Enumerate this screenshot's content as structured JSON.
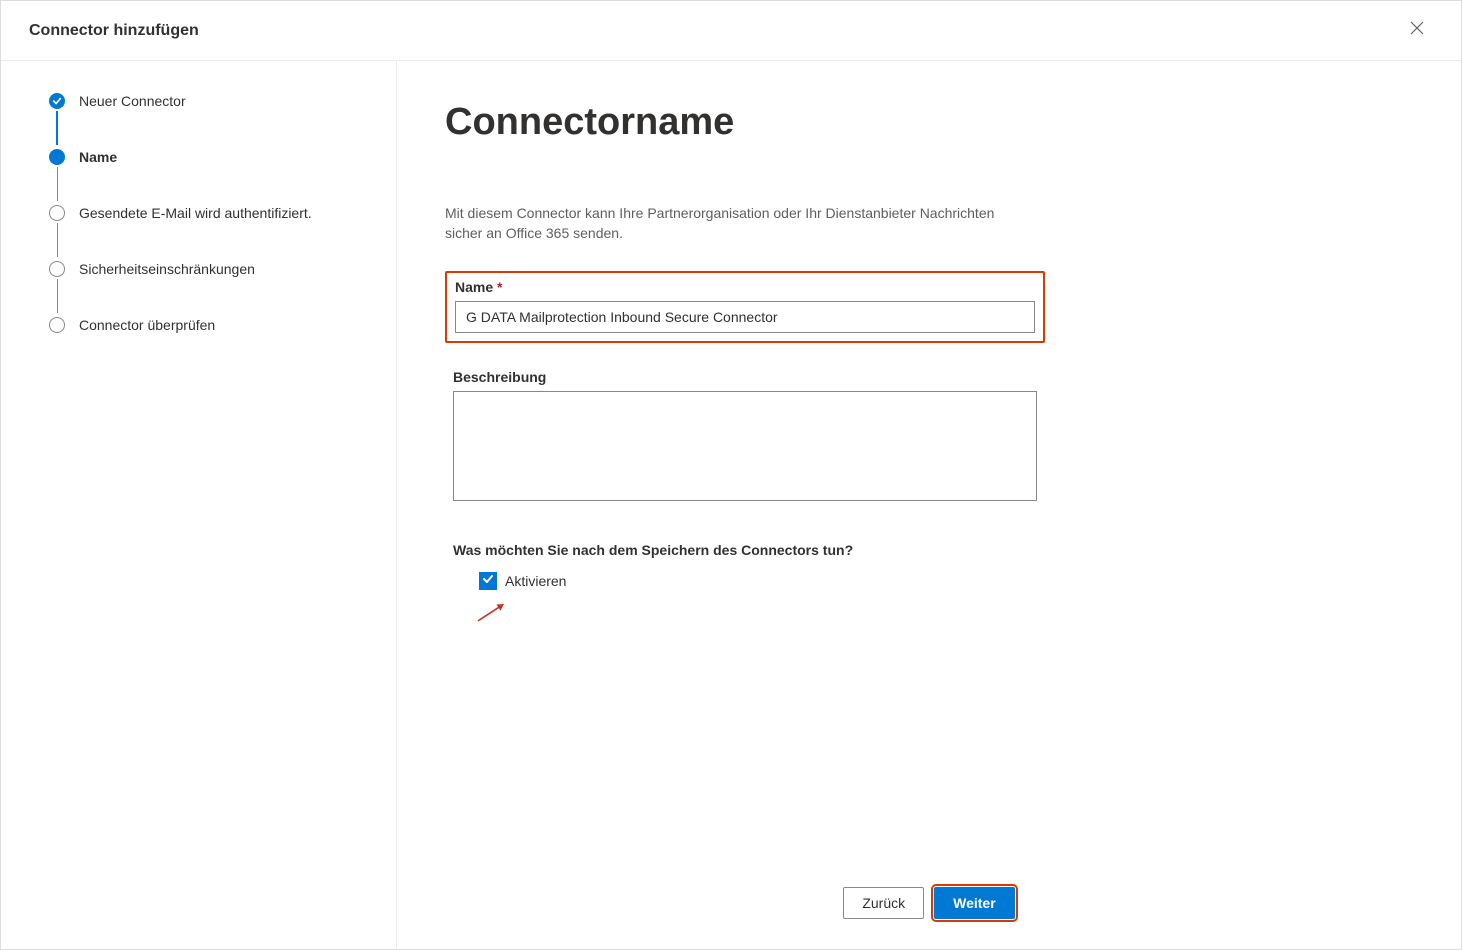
{
  "header": {
    "title": "Connector hinzufügen"
  },
  "sidebar": {
    "steps": [
      {
        "label": "Neuer Connector",
        "state": "completed"
      },
      {
        "label": "Name",
        "state": "current"
      },
      {
        "label": "Gesendete E-Mail wird authentifiziert.",
        "state": "upcoming"
      },
      {
        "label": "Sicherheitseinschränkungen",
        "state": "upcoming"
      },
      {
        "label": "Connector überprüfen",
        "state": "upcoming"
      }
    ]
  },
  "main": {
    "title": "Connectorname",
    "intro": "Mit diesem Connector kann Ihre Partnerorganisation oder Ihr Dienstanbieter Nachrichten sicher an Office 365 senden.",
    "name_label": "Name",
    "name_required_mark": "*",
    "name_value": "G DATA Mailprotection Inbound Secure Connector",
    "description_label": "Beschreibung",
    "description_value": "",
    "post_save_question": "Was möchten Sie nach dem Speichern des Connectors tun?",
    "activate_label": "Aktivieren",
    "activate_checked": true
  },
  "footer": {
    "back_label": "Zurück",
    "next_label": "Weiter"
  }
}
